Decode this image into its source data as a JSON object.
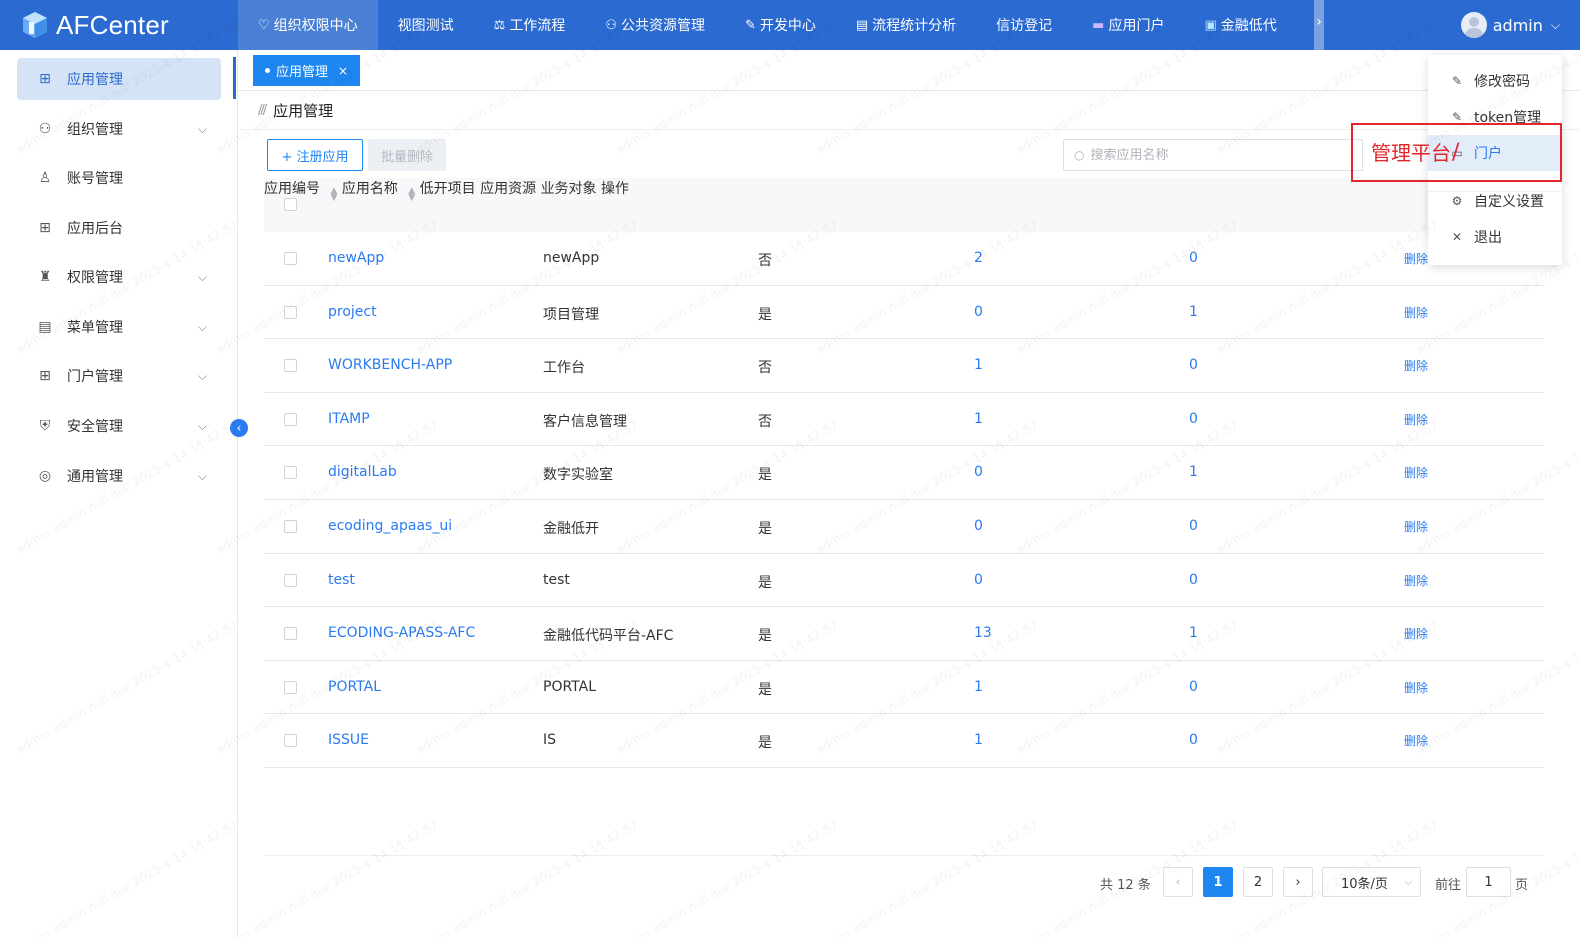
{
  "app": {
    "title": "AFCenter",
    "brand_color": "#2a6ad1",
    "accent_color": "#1e86f0"
  },
  "topnav": {
    "items": [
      {
        "label": "组织权限中心",
        "icon": "heart-shield-icon",
        "active": true
      },
      {
        "label": "视图测试",
        "icon": "",
        "active": false
      },
      {
        "label": "工作流程",
        "icon": "scale-icon",
        "active": false
      },
      {
        "label": "公共资源管理",
        "icon": "users-icon",
        "active": false
      },
      {
        "label": "开发中心",
        "icon": "edit-icon",
        "active": false
      },
      {
        "label": "流程统计分析",
        "icon": "chart-card-icon",
        "active": false
      },
      {
        "label": "信访登记",
        "icon": "",
        "active": false
      },
      {
        "label": "应用门户",
        "icon": "portal-icon",
        "active": false
      },
      {
        "label": "金融低代",
        "icon": "image-icon",
        "active": false
      }
    ],
    "more_glyph": "›"
  },
  "user": {
    "name": "admin",
    "caret": "⌵"
  },
  "sidebar": {
    "items": [
      {
        "label": "应用管理",
        "icon": "grid-icon",
        "active": true,
        "expandable": false
      },
      {
        "label": "组织管理",
        "icon": "group-icon",
        "active": false,
        "expandable": true
      },
      {
        "label": "账号管理",
        "icon": "user-icon",
        "active": false,
        "expandable": false
      },
      {
        "label": "应用后台",
        "icon": "grid-icon",
        "active": false,
        "expandable": false
      },
      {
        "label": "权限管理",
        "icon": "stamp-icon",
        "active": false,
        "expandable": true
      },
      {
        "label": "菜单管理",
        "icon": "menu-doc-icon",
        "active": false,
        "expandable": true
      },
      {
        "label": "门户管理",
        "icon": "grid-icon",
        "active": false,
        "expandable": true
      },
      {
        "label": "安全管理",
        "icon": "shield-icon",
        "active": false,
        "expandable": true
      },
      {
        "label": "通用管理",
        "icon": "target-icon",
        "active": false,
        "expandable": true
      }
    ]
  },
  "tabs": [
    {
      "label": "应用管理",
      "active": true,
      "close": "×"
    }
  ],
  "page": {
    "title": "应用管理"
  },
  "toolbar": {
    "register_label": "+ 注册应用",
    "batch_delete_label": "批量删除",
    "search_placeholder": "搜索应用名称"
  },
  "table": {
    "columns": [
      "应用编号",
      "应用名称",
      "低开项目",
      "应用资源",
      "业务对象",
      "操作"
    ],
    "rows": [
      {
        "code": "newApp",
        "name": "newApp",
        "low": "否",
        "res": "2",
        "obj": "0",
        "op": "删除"
      },
      {
        "code": "project",
        "name": "项目管理",
        "low": "是",
        "res": "0",
        "obj": "1",
        "op": "删除"
      },
      {
        "code": "WORKBENCH-APP",
        "name": "工作台",
        "low": "否",
        "res": "1",
        "obj": "0",
        "op": "删除"
      },
      {
        "code": "ITAMP",
        "name": "客户信息管理",
        "low": "否",
        "res": "1",
        "obj": "0",
        "op": "删除"
      },
      {
        "code": "digitalLab",
        "name": "数字实验室",
        "low": "是",
        "res": "0",
        "obj": "1",
        "op": "删除"
      },
      {
        "code": "ecoding_apaas_ui",
        "name": "金融低开",
        "low": "是",
        "res": "0",
        "obj": "0",
        "op": "删除"
      },
      {
        "code": "test",
        "name": "test",
        "low": "是",
        "res": "0",
        "obj": "0",
        "op": "删除"
      },
      {
        "code": "ECODING-APASS-AFC",
        "name": "金融低代码平台-AFC",
        "low": "是",
        "res": "13",
        "obj": "1",
        "op": "删除"
      },
      {
        "code": "PORTAL",
        "name": "PORTAL",
        "low": "是",
        "res": "1",
        "obj": "0",
        "op": "删除"
      },
      {
        "code": "ISSUE",
        "name": "IS",
        "low": "是",
        "res": "1",
        "obj": "0",
        "op": "删除"
      }
    ]
  },
  "pagination": {
    "total": "共 12 条",
    "prev": "‹",
    "pages": [
      "1",
      "2"
    ],
    "current": "1",
    "next": "›",
    "page_size": "10条/页",
    "goto_label": "前往",
    "goto_value": "1",
    "page_label": "页"
  },
  "user_menu": {
    "items": [
      {
        "label": "修改密码",
        "icon": "pencil-icon"
      },
      {
        "label": "token管理",
        "icon": "pencil-icon"
      },
      {
        "label": "门户",
        "icon": "portal-icon"
      },
      {
        "label": "自定义设置",
        "icon": "gear-icon"
      },
      {
        "label": "退出",
        "icon": "close-icon"
      }
    ]
  },
  "annotation": {
    "text": "管理平台",
    "color": "#e3262b"
  },
  "watermark": {
    "text": "admin admin null null 2023-4-14 15:42:57"
  }
}
